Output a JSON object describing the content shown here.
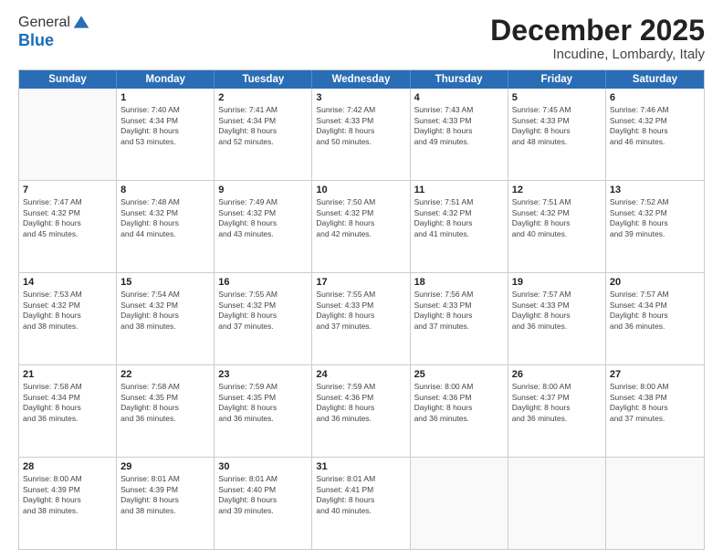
{
  "logo": {
    "general": "General",
    "blue": "Blue"
  },
  "header": {
    "month": "December 2025",
    "location": "Incudine, Lombardy, Italy"
  },
  "days": [
    "Sunday",
    "Monday",
    "Tuesday",
    "Wednesday",
    "Thursday",
    "Friday",
    "Saturday"
  ],
  "rows": [
    [
      {
        "day": "",
        "info": ""
      },
      {
        "day": "1",
        "info": "Sunrise: 7:40 AM\nSunset: 4:34 PM\nDaylight: 8 hours\nand 53 minutes."
      },
      {
        "day": "2",
        "info": "Sunrise: 7:41 AM\nSunset: 4:34 PM\nDaylight: 8 hours\nand 52 minutes."
      },
      {
        "day": "3",
        "info": "Sunrise: 7:42 AM\nSunset: 4:33 PM\nDaylight: 8 hours\nand 50 minutes."
      },
      {
        "day": "4",
        "info": "Sunrise: 7:43 AM\nSunset: 4:33 PM\nDaylight: 8 hours\nand 49 minutes."
      },
      {
        "day": "5",
        "info": "Sunrise: 7:45 AM\nSunset: 4:33 PM\nDaylight: 8 hours\nand 48 minutes."
      },
      {
        "day": "6",
        "info": "Sunrise: 7:46 AM\nSunset: 4:32 PM\nDaylight: 8 hours\nand 46 minutes."
      }
    ],
    [
      {
        "day": "7",
        "info": "Sunrise: 7:47 AM\nSunset: 4:32 PM\nDaylight: 8 hours\nand 45 minutes."
      },
      {
        "day": "8",
        "info": "Sunrise: 7:48 AM\nSunset: 4:32 PM\nDaylight: 8 hours\nand 44 minutes."
      },
      {
        "day": "9",
        "info": "Sunrise: 7:49 AM\nSunset: 4:32 PM\nDaylight: 8 hours\nand 43 minutes."
      },
      {
        "day": "10",
        "info": "Sunrise: 7:50 AM\nSunset: 4:32 PM\nDaylight: 8 hours\nand 42 minutes."
      },
      {
        "day": "11",
        "info": "Sunrise: 7:51 AM\nSunset: 4:32 PM\nDaylight: 8 hours\nand 41 minutes."
      },
      {
        "day": "12",
        "info": "Sunrise: 7:51 AM\nSunset: 4:32 PM\nDaylight: 8 hours\nand 40 minutes."
      },
      {
        "day": "13",
        "info": "Sunrise: 7:52 AM\nSunset: 4:32 PM\nDaylight: 8 hours\nand 39 minutes."
      }
    ],
    [
      {
        "day": "14",
        "info": "Sunrise: 7:53 AM\nSunset: 4:32 PM\nDaylight: 8 hours\nand 38 minutes."
      },
      {
        "day": "15",
        "info": "Sunrise: 7:54 AM\nSunset: 4:32 PM\nDaylight: 8 hours\nand 38 minutes."
      },
      {
        "day": "16",
        "info": "Sunrise: 7:55 AM\nSunset: 4:32 PM\nDaylight: 8 hours\nand 37 minutes."
      },
      {
        "day": "17",
        "info": "Sunrise: 7:55 AM\nSunset: 4:33 PM\nDaylight: 8 hours\nand 37 minutes."
      },
      {
        "day": "18",
        "info": "Sunrise: 7:56 AM\nSunset: 4:33 PM\nDaylight: 8 hours\nand 37 minutes."
      },
      {
        "day": "19",
        "info": "Sunrise: 7:57 AM\nSunset: 4:33 PM\nDaylight: 8 hours\nand 36 minutes."
      },
      {
        "day": "20",
        "info": "Sunrise: 7:57 AM\nSunset: 4:34 PM\nDaylight: 8 hours\nand 36 minutes."
      }
    ],
    [
      {
        "day": "21",
        "info": "Sunrise: 7:58 AM\nSunset: 4:34 PM\nDaylight: 8 hours\nand 36 minutes."
      },
      {
        "day": "22",
        "info": "Sunrise: 7:58 AM\nSunset: 4:35 PM\nDaylight: 8 hours\nand 36 minutes."
      },
      {
        "day": "23",
        "info": "Sunrise: 7:59 AM\nSunset: 4:35 PM\nDaylight: 8 hours\nand 36 minutes."
      },
      {
        "day": "24",
        "info": "Sunrise: 7:59 AM\nSunset: 4:36 PM\nDaylight: 8 hours\nand 36 minutes."
      },
      {
        "day": "25",
        "info": "Sunrise: 8:00 AM\nSunset: 4:36 PM\nDaylight: 8 hours\nand 36 minutes."
      },
      {
        "day": "26",
        "info": "Sunrise: 8:00 AM\nSunset: 4:37 PM\nDaylight: 8 hours\nand 36 minutes."
      },
      {
        "day": "27",
        "info": "Sunrise: 8:00 AM\nSunset: 4:38 PM\nDaylight: 8 hours\nand 37 minutes."
      }
    ],
    [
      {
        "day": "28",
        "info": "Sunrise: 8:00 AM\nSunset: 4:39 PM\nDaylight: 8 hours\nand 38 minutes."
      },
      {
        "day": "29",
        "info": "Sunrise: 8:01 AM\nSunset: 4:39 PM\nDaylight: 8 hours\nand 38 minutes."
      },
      {
        "day": "30",
        "info": "Sunrise: 8:01 AM\nSunset: 4:40 PM\nDaylight: 8 hours\nand 39 minutes."
      },
      {
        "day": "31",
        "info": "Sunrise: 8:01 AM\nSunset: 4:41 PM\nDaylight: 8 hours\nand 40 minutes."
      },
      {
        "day": "",
        "info": ""
      },
      {
        "day": "",
        "info": ""
      },
      {
        "day": "",
        "info": ""
      }
    ]
  ]
}
